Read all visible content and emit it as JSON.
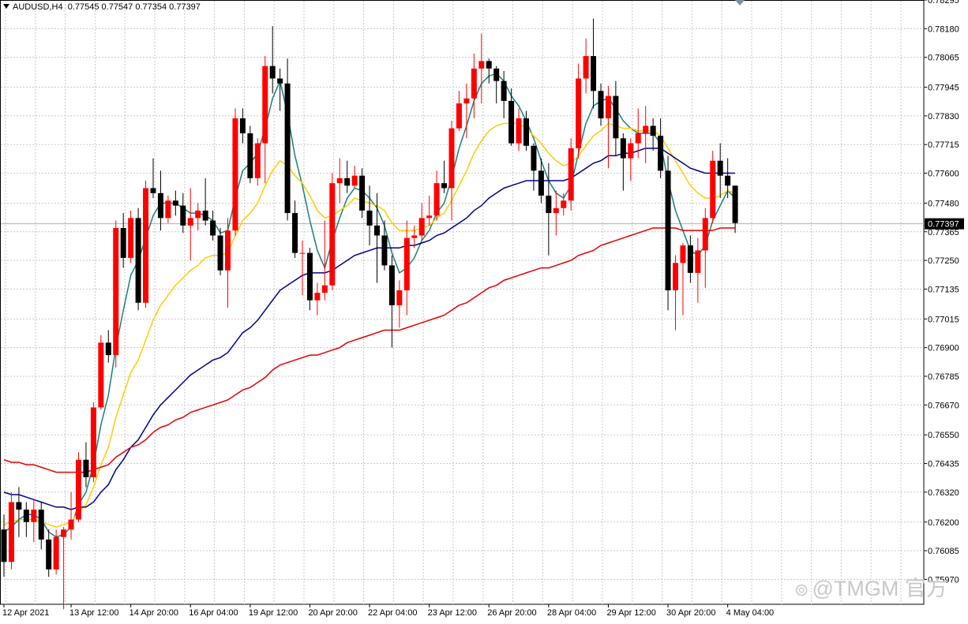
{
  "header": {
    "symbol": "AUDUSD,H4",
    "ohlc": "0.77545 0.77547 0.77354 0.77397"
  },
  "watermark": {
    "text": "@TMGM 官方"
  },
  "colors": {
    "bull": "#ff0000",
    "bear": "#000000",
    "ma_fast": "#1a7f7a",
    "ma_yellow": "#ffcc00",
    "ma_blue": "#00008b",
    "ma_red": "#e00000",
    "grid": "#c8c8c8",
    "price_tag_bg": "#000000",
    "price_tag_fg": "#ffffff"
  },
  "chart_data": {
    "type": "candlestick",
    "instrument": "AUDUSD",
    "timeframe": "H4",
    "current_price": 0.77397,
    "current_price_label": "0.77397",
    "ylim": [
      0.7587,
      0.78295
    ],
    "y_ticks": [
      0.78295,
      0.7818,
      0.78065,
      0.77945,
      0.7783,
      0.77715,
      0.776,
      0.7748,
      0.77365,
      0.7725,
      0.77135,
      0.77015,
      0.769,
      0.76785,
      0.7667,
      0.7655,
      0.76435,
      0.7632,
      0.762,
      0.76085,
      0.7597
    ],
    "y_tick_labels": [
      "0.78295",
      "0.78180",
      "0.78065",
      "0.77945",
      "0.77830",
      "0.77715",
      "0.77600",
      "0.77480",
      "0.77365",
      "0.77250",
      "0.77135",
      "0.77015",
      "0.76900",
      "0.76785",
      "0.76670",
      "0.76550",
      "0.76435",
      "0.76320",
      "0.76200",
      "0.76085",
      "0.75970"
    ],
    "x_ticks": [
      {
        "label": "12 Apr 2021",
        "bar": 0
      },
      {
        "label": "13 Apr 12:00",
        "bar": 9
      },
      {
        "label": "14 Apr 20:00",
        "bar": 17
      },
      {
        "label": "16 Apr 04:00",
        "bar": 25
      },
      {
        "label": "19 Apr 12:00",
        "bar": 33
      },
      {
        "label": "20 Apr 20:00",
        "bar": 41
      },
      {
        "label": "22 Apr 04:00",
        "bar": 49
      },
      {
        "label": "23 Apr 12:00",
        "bar": 57
      },
      {
        "label": "26 Apr 20:00",
        "bar": 65
      },
      {
        "label": "28 Apr 04:00",
        "bar": 73
      },
      {
        "label": "29 Apr 12:00",
        "bar": 81
      },
      {
        "label": "30 Apr 20:00",
        "bar": 89
      },
      {
        "label": "4 May 04:00",
        "bar": 97
      }
    ],
    "candles": [
      [
        0.7617,
        0.7623,
        0.7598,
        0.7604
      ],
      [
        0.7604,
        0.7632,
        0.7601,
        0.7628
      ],
      [
        0.7628,
        0.7634,
        0.7614,
        0.7625
      ],
      [
        0.7625,
        0.7628,
        0.7614,
        0.762
      ],
      [
        0.762,
        0.7629,
        0.7612,
        0.7625
      ],
      [
        0.7625,
        0.7628,
        0.7609,
        0.7613
      ],
      [
        0.7613,
        0.7617,
        0.7598,
        0.7601
      ],
      [
        0.7601,
        0.7617,
        0.7599,
        0.7614
      ],
      [
        0.7614,
        0.7618,
        0.7585,
        0.7617
      ],
      [
        0.7617,
        0.7632,
        0.7613,
        0.7621
      ],
      [
        0.7621,
        0.7648,
        0.762,
        0.7645
      ],
      [
        0.7645,
        0.7652,
        0.7634,
        0.7638
      ],
      [
        0.7638,
        0.7668,
        0.7636,
        0.7666
      ],
      [
        0.7666,
        0.7695,
        0.7665,
        0.7692
      ],
      [
        0.7692,
        0.7697,
        0.7684,
        0.7687
      ],
      [
        0.7687,
        0.7741,
        0.7682,
        0.7738
      ],
      [
        0.7738,
        0.7744,
        0.7722,
        0.7726
      ],
      [
        0.7726,
        0.7745,
        0.7724,
        0.7742
      ],
      [
        0.7742,
        0.7746,
        0.7705,
        0.7708
      ],
      [
        0.7708,
        0.7757,
        0.7706,
        0.7754
      ],
      [
        0.7754,
        0.7766,
        0.775,
        0.7752
      ],
      [
        0.7752,
        0.7761,
        0.7737,
        0.7742
      ],
      [
        0.7742,
        0.7751,
        0.774,
        0.7749
      ],
      [
        0.7749,
        0.7753,
        0.7743,
        0.7747
      ],
      [
        0.7747,
        0.7752,
        0.7736,
        0.7739
      ],
      [
        0.7739,
        0.7754,
        0.7725,
        0.7742
      ],
      [
        0.7742,
        0.7748,
        0.7737,
        0.7745
      ],
      [
        0.7745,
        0.7758,
        0.7739,
        0.7741
      ],
      [
        0.7741,
        0.7745,
        0.7733,
        0.7735
      ],
      [
        0.7735,
        0.7738,
        0.7719,
        0.7721
      ],
      [
        0.7721,
        0.7742,
        0.7706,
        0.7737
      ],
      [
        0.7737,
        0.7786,
        0.7735,
        0.7782
      ],
      [
        0.7782,
        0.7786,
        0.7772,
        0.7776
      ],
      [
        0.7776,
        0.7779,
        0.7756,
        0.7758
      ],
      [
        0.7758,
        0.7774,
        0.7755,
        0.7772
      ],
      [
        0.7772,
        0.7807,
        0.7756,
        0.7803
      ],
      [
        0.7803,
        0.7819,
        0.7792,
        0.7798
      ],
      [
        0.7798,
        0.7802,
        0.7785,
        0.7796
      ],
      [
        0.7796,
        0.7806,
        0.7741,
        0.7744
      ],
      [
        0.7744,
        0.7749,
        0.7726,
        0.7728
      ],
      [
        0.7728,
        0.7733,
        0.7711,
        0.7728
      ],
      [
        0.7728,
        0.773,
        0.7705,
        0.7709
      ],
      [
        0.7709,
        0.7716,
        0.7703,
        0.7712
      ],
      [
        0.7712,
        0.7741,
        0.7709,
        0.7715
      ],
      [
        0.7715,
        0.776,
        0.7713,
        0.7756
      ],
      [
        0.7756,
        0.7766,
        0.7748,
        0.7758
      ],
      [
        0.7758,
        0.7765,
        0.7752,
        0.7755
      ],
      [
        0.7755,
        0.7763,
        0.7754,
        0.7759
      ],
      [
        0.7759,
        0.7762,
        0.7742,
        0.7745
      ],
      [
        0.7745,
        0.7755,
        0.7731,
        0.7739
      ],
      [
        0.7739,
        0.7752,
        0.7716,
        0.7735
      ],
      [
        0.7735,
        0.7741,
        0.7721,
        0.7723
      ],
      [
        0.7723,
        0.7727,
        0.769,
        0.7707
      ],
      [
        0.7707,
        0.7717,
        0.7698,
        0.7713
      ],
      [
        0.7713,
        0.7741,
        0.7703,
        0.7734
      ],
      [
        0.7734,
        0.7739,
        0.773,
        0.7735
      ],
      [
        0.7735,
        0.7748,
        0.7733,
        0.7742
      ],
      [
        0.7742,
        0.7751,
        0.7739,
        0.7743
      ],
      [
        0.7743,
        0.7761,
        0.7741,
        0.7756
      ],
      [
        0.7756,
        0.7765,
        0.7752,
        0.7754
      ],
      [
        0.7754,
        0.7781,
        0.7741,
        0.7778
      ],
      [
        0.7778,
        0.7793,
        0.7777,
        0.7788
      ],
      [
        0.7788,
        0.7796,
        0.7774,
        0.779
      ],
      [
        0.779,
        0.7808,
        0.7782,
        0.7802
      ],
      [
        0.7802,
        0.7816,
        0.7788,
        0.7805
      ],
      [
        0.7805,
        0.7806,
        0.7796,
        0.7802
      ],
      [
        0.7802,
        0.7803,
        0.7788,
        0.7797
      ],
      [
        0.7797,
        0.7801,
        0.7782,
        0.7789
      ],
      [
        0.7789,
        0.7794,
        0.7771,
        0.7772
      ],
      [
        0.7772,
        0.7786,
        0.7769,
        0.7782
      ],
      [
        0.7782,
        0.7785,
        0.7769,
        0.7771
      ],
      [
        0.7771,
        0.7772,
        0.7753,
        0.7761
      ],
      [
        0.7761,
        0.7766,
        0.7748,
        0.7751
      ],
      [
        0.7751,
        0.7764,
        0.7727,
        0.7744
      ],
      [
        0.7744,
        0.7753,
        0.7735,
        0.7746
      ],
      [
        0.7746,
        0.7752,
        0.7743,
        0.7749
      ],
      [
        0.7749,
        0.7774,
        0.7745,
        0.777
      ],
      [
        0.777,
        0.7804,
        0.7766,
        0.7798
      ],
      [
        0.7798,
        0.7814,
        0.7792,
        0.7807
      ],
      [
        0.7807,
        0.7822,
        0.7786,
        0.7793
      ],
      [
        0.7793,
        0.7796,
        0.7779,
        0.7782
      ],
      [
        0.7782,
        0.7795,
        0.7762,
        0.7791
      ],
      [
        0.7791,
        0.7797,
        0.7767,
        0.7774
      ],
      [
        0.7774,
        0.7776,
        0.7753,
        0.7766
      ],
      [
        0.7766,
        0.7774,
        0.7757,
        0.7772
      ],
      [
        0.7772,
        0.7786,
        0.7766,
        0.7776
      ],
      [
        0.7776,
        0.7787,
        0.7764,
        0.7779
      ],
      [
        0.7779,
        0.7782,
        0.7769,
        0.7775
      ],
      [
        0.7775,
        0.7782,
        0.7758,
        0.7761
      ],
      [
        0.7761,
        0.7767,
        0.7705,
        0.7713
      ],
      [
        0.7713,
        0.7727,
        0.7697,
        0.7724
      ],
      [
        0.7724,
        0.7732,
        0.7703,
        0.7731
      ],
      [
        0.7731,
        0.7735,
        0.7716,
        0.772
      ],
      [
        0.772,
        0.7734,
        0.7708,
        0.7729
      ],
      [
        0.7729,
        0.7746,
        0.7714,
        0.7742
      ],
      [
        0.7742,
        0.7769,
        0.774,
        0.7765
      ],
      [
        0.7765,
        0.7772,
        0.775,
        0.7759
      ],
      [
        0.7759,
        0.7766,
        0.775,
        0.7755
      ],
      [
        0.7755,
        0.7755,
        0.7736,
        0.774
      ]
    ],
    "series": [
      {
        "color": "#1a7f7a",
        "values": [
          0.7616,
          0.7618,
          0.7621,
          0.7623,
          0.7623,
          0.7621,
          0.7616,
          0.7614,
          0.7615,
          0.7618,
          0.7627,
          0.7632,
          0.7643,
          0.7659,
          0.7671,
          0.769,
          0.7705,
          0.7719,
          0.7725,
          0.7734,
          0.7743,
          0.7748,
          0.7748,
          0.7748,
          0.7746,
          0.7744,
          0.7744,
          0.7743,
          0.7741,
          0.7736,
          0.7737,
          0.775,
          0.7761,
          0.7764,
          0.7768,
          0.7778,
          0.779,
          0.7797,
          0.7784,
          0.7767,
          0.7755,
          0.7741,
          0.7729,
          0.7722,
          0.7733,
          0.7742,
          0.775,
          0.7754,
          0.7753,
          0.775,
          0.7746,
          0.7739,
          0.7728,
          0.772,
          0.7722,
          0.7726,
          0.7733,
          0.7737,
          0.7744,
          0.7748,
          0.7758,
          0.777,
          0.7779,
          0.7789,
          0.7796,
          0.7799,
          0.78,
          0.7797,
          0.7791,
          0.7787,
          0.7781,
          0.7774,
          0.7765,
          0.7757,
          0.7752,
          0.775,
          0.7755,
          0.7768,
          0.778,
          0.7787,
          0.7789,
          0.779,
          0.7786,
          0.7781,
          0.7778,
          0.7776,
          0.7776,
          0.7776,
          0.7772,
          0.7757,
          0.7745,
          0.7737,
          0.7729,
          0.7727,
          0.7731,
          0.7741,
          0.7747,
          0.7753,
          0.775
        ]
      },
      {
        "color": "#ffcc00",
        "values": [
          0.7619,
          0.762,
          0.7621,
          0.7621,
          0.7621,
          0.762,
          0.7619,
          0.7618,
          0.7619,
          0.762,
          0.7624,
          0.7627,
          0.7634,
          0.7643,
          0.765,
          0.7662,
          0.7671,
          0.768,
          0.7685,
          0.7693,
          0.7701,
          0.7707,
          0.7711,
          0.7715,
          0.7718,
          0.7721,
          0.7723,
          0.7726,
          0.7727,
          0.7727,
          0.7728,
          0.7735,
          0.7741,
          0.7744,
          0.7748,
          0.7755,
          0.7761,
          0.7765,
          0.7763,
          0.7759,
          0.7756,
          0.7751,
          0.7745,
          0.7742,
          0.7743,
          0.7745,
          0.7747,
          0.775,
          0.7749,
          0.7748,
          0.7747,
          0.7745,
          0.774,
          0.7737,
          0.7737,
          0.7737,
          0.7738,
          0.7739,
          0.7742,
          0.7744,
          0.7749,
          0.7755,
          0.7761,
          0.7768,
          0.7773,
          0.7777,
          0.7779,
          0.778,
          0.778,
          0.778,
          0.7778,
          0.7775,
          0.7772,
          0.7768,
          0.7765,
          0.7763,
          0.7764,
          0.7767,
          0.7771,
          0.7775,
          0.7777,
          0.778,
          0.7779,
          0.7778,
          0.7778,
          0.7777,
          0.7777,
          0.7777,
          0.7775,
          0.777,
          0.7765,
          0.776,
          0.7755,
          0.7752,
          0.775,
          0.775,
          0.7751,
          0.7753,
          0.7752
        ]
      },
      {
        "color": "#00008b",
        "values": [
          0.7632,
          0.7631,
          0.7631,
          0.763,
          0.7629,
          0.7628,
          0.7627,
          0.7626,
          0.7626,
          0.7625,
          0.7626,
          0.7626,
          0.7628,
          0.7632,
          0.7635,
          0.7641,
          0.7645,
          0.765,
          0.7653,
          0.7658,
          0.7663,
          0.7667,
          0.767,
          0.7673,
          0.7676,
          0.7679,
          0.7681,
          0.7683,
          0.7685,
          0.7686,
          0.7688,
          0.7692,
          0.7696,
          0.7698,
          0.7701,
          0.7705,
          0.7709,
          0.7713,
          0.7715,
          0.7717,
          0.7719,
          0.772,
          0.772,
          0.772,
          0.7721,
          0.7723,
          0.7725,
          0.7727,
          0.7728,
          0.7729,
          0.773,
          0.773,
          0.773,
          0.773,
          0.7731,
          0.7731,
          0.7732,
          0.7733,
          0.7735,
          0.7736,
          0.7738,
          0.774,
          0.7742,
          0.7745,
          0.7747,
          0.775,
          0.7752,
          0.7754,
          0.7755,
          0.7756,
          0.7757,
          0.7757,
          0.7757,
          0.7757,
          0.7757,
          0.7757,
          0.7758,
          0.776,
          0.7762,
          0.7764,
          0.7765,
          0.7767,
          0.7767,
          0.7768,
          0.7768,
          0.7769,
          0.777,
          0.777,
          0.777,
          0.7768,
          0.7766,
          0.7764,
          0.7762,
          0.7761,
          0.776,
          0.776,
          0.776,
          0.776,
          0.776
        ]
      },
      {
        "color": "#e00000",
        "values": [
          0.7645,
          0.7644,
          0.7644,
          0.7643,
          0.7643,
          0.7642,
          0.7641,
          0.764,
          0.764,
          0.764,
          0.764,
          0.764,
          0.7641,
          0.7642,
          0.7643,
          0.7646,
          0.7648,
          0.765,
          0.7651,
          0.7653,
          0.7656,
          0.7658,
          0.7659,
          0.7661,
          0.7662,
          0.7664,
          0.7665,
          0.7666,
          0.7667,
          0.7668,
          0.7669,
          0.7671,
          0.7673,
          0.7674,
          0.7676,
          0.7678,
          0.7681,
          0.7683,
          0.7684,
          0.7685,
          0.7686,
          0.7687,
          0.7687,
          0.7688,
          0.7689,
          0.769,
          0.7692,
          0.7693,
          0.7694,
          0.7695,
          0.7696,
          0.7697,
          0.7697,
          0.7697,
          0.7698,
          0.7699,
          0.77,
          0.7701,
          0.7702,
          0.7703,
          0.7705,
          0.7707,
          0.7708,
          0.771,
          0.7712,
          0.7714,
          0.7715,
          0.7717,
          0.7718,
          0.7719,
          0.772,
          0.7721,
          0.7722,
          0.7722,
          0.7723,
          0.7724,
          0.7725,
          0.7727,
          0.7728,
          0.7729,
          0.7731,
          0.7732,
          0.7733,
          0.7734,
          0.7735,
          0.7736,
          0.7737,
          0.7738,
          0.7738,
          0.7738,
          0.7738,
          0.7737,
          0.7737,
          0.7737,
          0.7737,
          0.7737,
          0.7738,
          0.7738,
          0.7738
        ]
      }
    ]
  }
}
